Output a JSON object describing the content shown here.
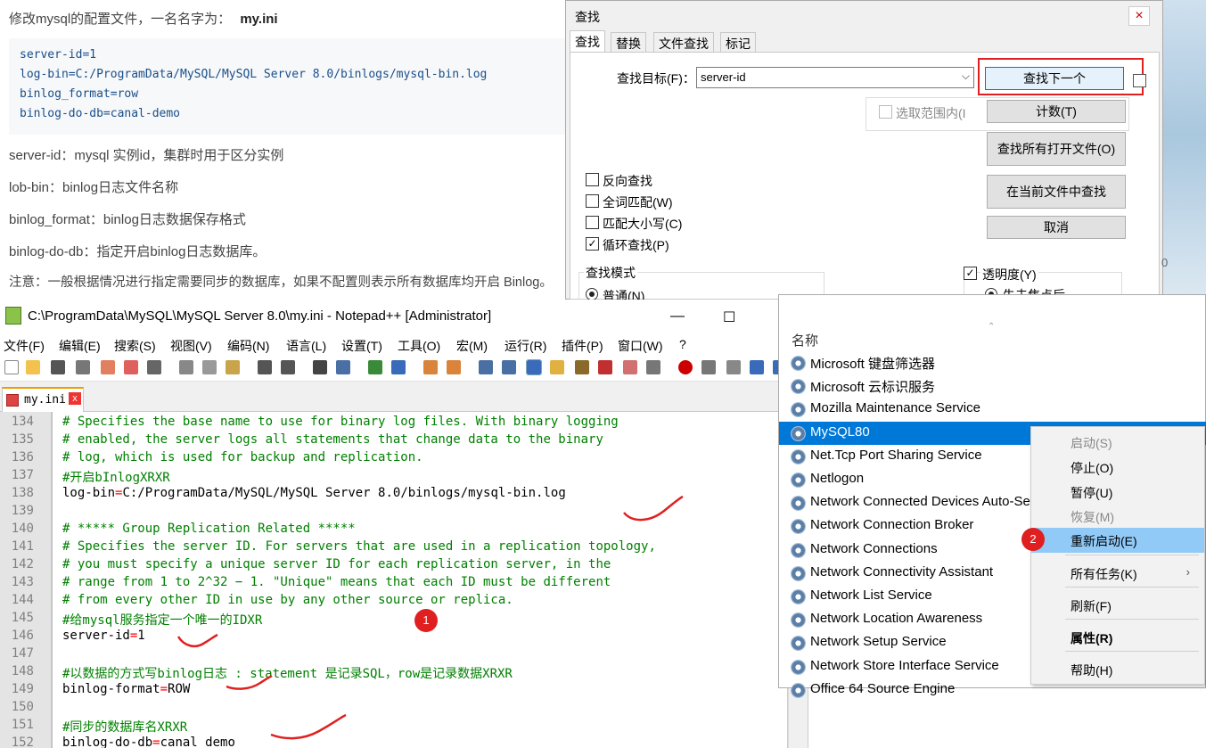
{
  "article": {
    "intro": "修改mysql的配置文件，一名名字为：",
    "filename": "my.ini",
    "code": [
      "server-id=1",
      "log-bin=C:/ProgramData/MySQL/MySQL Server 8.0/binlogs/mysql-bin.log",
      "binlog_format=row",
      "binlog-do-db=canal-demo"
    ],
    "lines": [
      "server-id：mysql 实例id，集群时用于区分实例",
      "lob-bin：binlog日志文件名称",
      "binlog_format：binlog日志数据保存格式",
      "binlog-do-db：指定开启binlog日志数据库。",
      "注意：一般根据情况进行指定需要同步的数据库，如果不配置则表示所有数据库均开启 Binlog。"
    ]
  },
  "find_dialog": {
    "title": "查找",
    "close": "×",
    "tabs": [
      "查找",
      "替换",
      "文件查找",
      "标记"
    ],
    "target_label": "查找目标(F)：",
    "target_value": "server-id",
    "dropdown": "⌵",
    "btn_find_next": "查找下一个",
    "in_selection": "选取范围内(I",
    "btn_count": "计数(T)",
    "btn_find_all_open": "查找所有打开文件(O)",
    "btn_find_in_current": "在当前文件中查找",
    "btn_cancel": "取消",
    "options": [
      {
        "label": "反向查找",
        "checked": ""
      },
      {
        "label": "全词匹配(W)",
        "checked": ""
      },
      {
        "label": "匹配大小写(C)",
        "checked": ""
      },
      {
        "label": "循环查找(P)",
        "checked": "✓"
      }
    ],
    "mode_label": "查找模式",
    "mode_normal": "普通(N)",
    "transparency": "透明度(Y)",
    "transparency_checked": "✓",
    "trans_option": "失去焦点后",
    "zero": "0"
  },
  "notepad": {
    "title": "C:\\ProgramData\\MySQL\\MySQL Server 8.0\\my.ini - Notepad++ [Administrator]",
    "minimize": "—",
    "maximize": "☐",
    "menus": [
      "文件(F)",
      "编辑(E)",
      "搜索(S)",
      "视图(V)",
      "编码(N)",
      "语言(L)",
      "设置(T)",
      "工具(O)",
      "宏(M)",
      "运行(R)",
      "插件(P)",
      "窗口(W)",
      "?"
    ],
    "tab_name": "my.ini",
    "tab_close": "x",
    "line_numbers": [
      "134",
      "135",
      "136",
      "137",
      "138",
      "139",
      "140",
      "141",
      "142",
      "143",
      "144",
      "145",
      "146",
      "147",
      "148",
      "149",
      "150",
      "151",
      "152"
    ],
    "lines": [
      {
        "c": "# Specifies the base name to use for binary log files. With binary logging"
      },
      {
        "c": "# enabled, the server logs all statements that change data to the binary"
      },
      {
        "c": "# log, which is used for backup and replication."
      },
      {
        "c": "#开启bInlogXRXR"
      },
      {
        "k": "log-bin",
        "e": "=",
        "v": "C:/ProgramData/MySQL/MySQL Server 8.0/binlogs/mysql-bin.log"
      },
      {
        "c": ""
      },
      {
        "c": "# ***** Group Replication Related *****"
      },
      {
        "c": "# Specifies the server ID. For servers that are used in a replication topology,"
      },
      {
        "c": "# you must specify a unique server ID for each replication server, in the"
      },
      {
        "c": "# range from 1 to 2^32 − 1. \"Unique\" means that each ID must be different"
      },
      {
        "c": "# from every other ID in use by any other source or replica."
      },
      {
        "c": "#给mysql服务指定一个唯一的IDXR"
      },
      {
        "k": "server-id",
        "e": "=",
        "v": "1"
      },
      {
        "c": ""
      },
      {
        "c": "#以数据的方式写binlog日志 : statement 是记录SQL，row是记录数据XRXR"
      },
      {
        "k": "binlog-format",
        "e": "=",
        "v": "ROW"
      },
      {
        "c": ""
      },
      {
        "c": "#同步的数据库名XRXR"
      },
      {
        "k": "binlog-do-db",
        "e": "=",
        "v": "canal_demo"
      }
    ]
  },
  "services": {
    "header": "名称",
    "sort_indicator": "⌃",
    "items": [
      "Microsoft 键盘筛选器",
      "Microsoft 云标识服务",
      "Mozilla Maintenance Service",
      "MySQL80",
      "Net.Tcp Port Sharing Service",
      "Netlogon",
      "Network Connected Devices Auto-Se",
      "Network Connection Broker",
      "Network Connections",
      "Network Connectivity Assistant",
      "Network List Service",
      "Network Location Awareness",
      "Network Setup Service",
      "Network Store Interface Service",
      "Office 64 Source Engine"
    ],
    "selected": "MySQL80"
  },
  "context_menu": {
    "items": [
      {
        "label": "启动(S)"
      },
      {
        "label": "停止(O)"
      },
      {
        "label": "暂停(U)"
      },
      {
        "label": "恢复(M)"
      },
      {
        "label": "重新启动(E)"
      },
      {
        "label": "所有任务(K)"
      },
      {
        "label": "刷新(F)"
      },
      {
        "label": "属性(R)"
      },
      {
        "label": "帮助(H)"
      }
    ],
    "submenu_arrow": "›"
  },
  "badges": [
    "1",
    "2"
  ],
  "colors": {
    "accent": "#0078d7",
    "highlight": "#91c9f7",
    "annotation_red": "#e02020",
    "comment_green": "#008000"
  }
}
